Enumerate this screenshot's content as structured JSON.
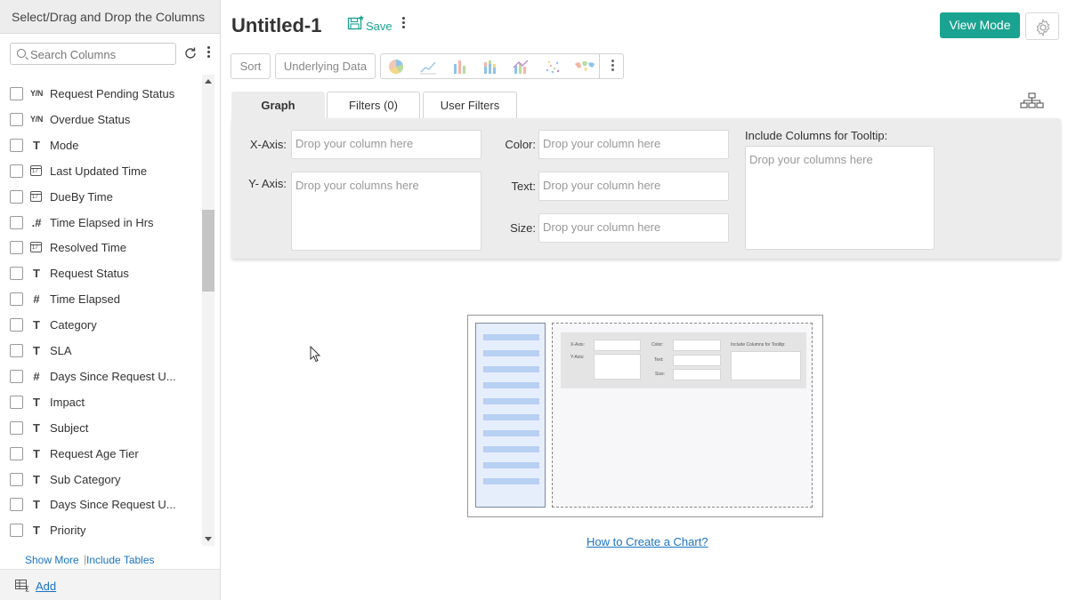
{
  "sidebar": {
    "header": "Select/Drag and Drop the Columns",
    "search_placeholder": "Search Columns",
    "columns": [
      {
        "type": "bool",
        "type_label": "Y/N",
        "label": "Request Pending Status"
      },
      {
        "type": "bool",
        "type_label": "Y/N",
        "label": "Overdue Status"
      },
      {
        "type": "text",
        "type_label": "T",
        "label": "Mode"
      },
      {
        "type": "date",
        "type_label": "",
        "label": "Last Updated Time"
      },
      {
        "type": "date",
        "type_label": "",
        "label": "DueBy Time"
      },
      {
        "type": "decimal",
        "type_label": ".#",
        "label": "Time Elapsed in Hrs"
      },
      {
        "type": "date",
        "type_label": "",
        "label": "Resolved Time"
      },
      {
        "type": "text",
        "type_label": "T",
        "label": "Request Status"
      },
      {
        "type": "number",
        "type_label": "#",
        "label": "Time Elapsed"
      },
      {
        "type": "text",
        "type_label": "T",
        "label": "Category"
      },
      {
        "type": "text",
        "type_label": "T",
        "label": "SLA"
      },
      {
        "type": "number",
        "type_label": "#",
        "label": "Days Since Request U..."
      },
      {
        "type": "text",
        "type_label": "T",
        "label": "Impact"
      },
      {
        "type": "text",
        "type_label": "T",
        "label": "Subject"
      },
      {
        "type": "text",
        "type_label": "T",
        "label": "Request Age Tier"
      },
      {
        "type": "text",
        "type_label": "T",
        "label": "Sub Category"
      },
      {
        "type": "text",
        "type_label": "T",
        "label": "Days Since Request U..."
      },
      {
        "type": "text",
        "type_label": "T",
        "label": "Priority"
      }
    ],
    "show_more": "Show More",
    "include_tables": "Include Tables",
    "add": "Add"
  },
  "header": {
    "title": "Untitled-1",
    "save": "Save",
    "view_mode": "View Mode"
  },
  "toolbar": {
    "sort": "Sort",
    "underlying_data": "Underlying Data",
    "chart_icons": [
      "pie-chart-icon",
      "line-chart-icon",
      "bar-chart-icon",
      "stacked-bar-icon",
      "combo-chart-icon",
      "scatter-chart-icon",
      "map-chart-icon"
    ]
  },
  "tabs": {
    "graph": "Graph",
    "filters": "Filters",
    "filters_count": "(0)",
    "user_filters": "User Filters"
  },
  "shelf": {
    "x_axis_label": "X-Axis:",
    "y_axis_label": "Y- Axis:",
    "color_label": "Color:",
    "text_label": "Text:",
    "size_label": "Size:",
    "tooltip_label": "Include Columns for Tooltip:",
    "drop_column": "Drop your column here",
    "drop_columns": "Drop your columns here"
  },
  "illustration": {
    "x_axis": "X-Axis:",
    "y_axis": "Y-Axis:",
    "color": "Color:",
    "text": "Text:",
    "size": "Size:",
    "tooltip": "Include Columns for Tooltip:"
  },
  "help_link": "How to Create a Chart?",
  "colors": {
    "accent": "#1aa390",
    "link": "#1a73c4",
    "panel_bg": "#ececec"
  }
}
